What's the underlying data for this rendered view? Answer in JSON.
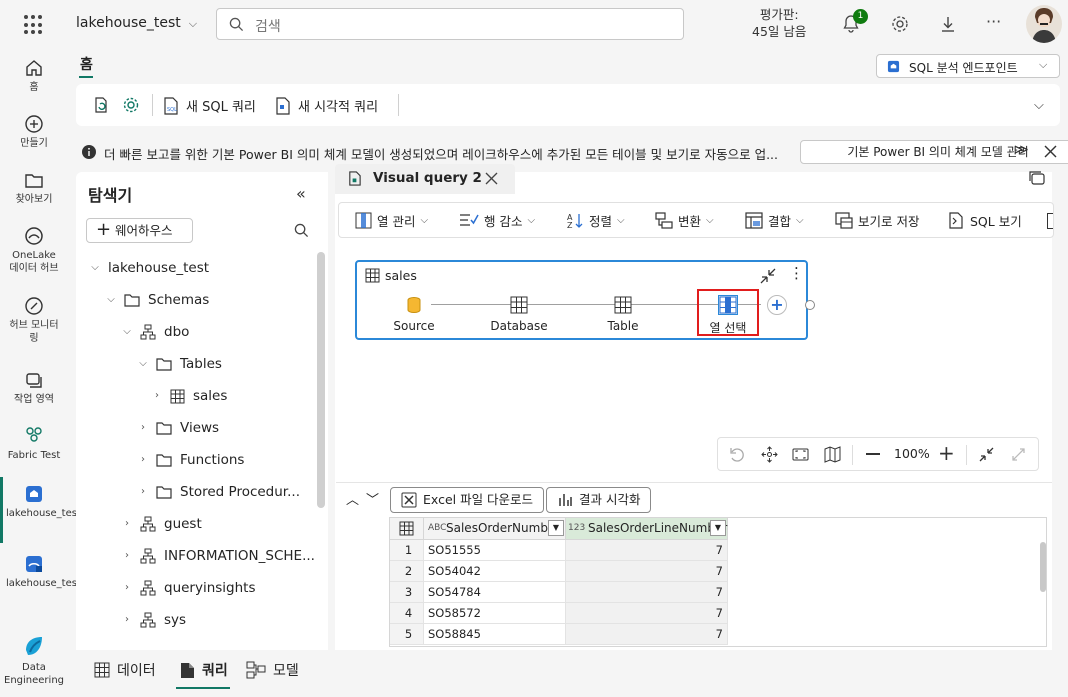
{
  "topbar": {
    "workspace": "lakehouse_test",
    "search_placeholder": "검색",
    "trial_line1": "평가판:",
    "trial_line2": "45일 남음",
    "notifications_count": "1"
  },
  "nav": {
    "items": [
      {
        "label": "홈"
      },
      {
        "label": "만들기"
      },
      {
        "label": "찾아보기"
      },
      {
        "label": "OneLake 데이터 허브"
      },
      {
        "label": "허브 모니터링"
      },
      {
        "label": "작업 영역"
      },
      {
        "label": "Fabric Test"
      },
      {
        "label": "lakehouse_test"
      },
      {
        "label": "lakehouse_test"
      },
      {
        "label": "Data Engineering"
      }
    ]
  },
  "header": {
    "home_tab": "홈",
    "endpoint": "SQL 분석 엔드포인트"
  },
  "ribbon": {
    "new_sql_query": "새 SQL 쿼리",
    "new_visual_query": "새 시각적 쿼리"
  },
  "infobar": {
    "message": "더 빠른 보고를 위한 기본 Power BI 의미 체계 모델이 생성되었으며 레이크하우스에 추가된 모든 테이블 및 보기로 자동으로 업...",
    "manage_button": "기본 Power BI 의미 체계 모델 관리"
  },
  "explorer": {
    "title": "탐색기",
    "add_warehouse": "웨어하우스",
    "tree": [
      {
        "label": "lakehouse_test"
      },
      {
        "label": "Schemas"
      },
      {
        "label": "dbo"
      },
      {
        "label": "Tables"
      },
      {
        "label": "sales"
      },
      {
        "label": "Views"
      },
      {
        "label": "Functions"
      },
      {
        "label": "Stored Procedur..."
      },
      {
        "label": "guest"
      },
      {
        "label": "INFORMATION_SCHE..."
      },
      {
        "label": "queryinsights"
      },
      {
        "label": "sys"
      }
    ]
  },
  "query": {
    "tab_title": "Visual query 2",
    "toolbar": {
      "manage_columns": "열 관리",
      "reduce_rows": "행 감소",
      "sort": "정렬",
      "transform": "변환",
      "combine": "결합",
      "save_as_view": "보기로 저장",
      "view_sql": "SQL 보기"
    },
    "card_title": "sales",
    "steps": [
      {
        "label": "Source"
      },
      {
        "label": "Database"
      },
      {
        "label": "Table"
      },
      {
        "label": "열 선택"
      }
    ],
    "zoom": "100%"
  },
  "results": {
    "download_excel": "Excel 파일 다운로드",
    "visualize": "결과 시각화",
    "columns": [
      {
        "name": "SalesOrderNumber",
        "type": "ABC"
      },
      {
        "name": "SalesOrderLineNumber",
        "type": "123"
      }
    ],
    "rows": [
      {
        "n": "1",
        "order": "SO51555",
        "line": "7"
      },
      {
        "n": "2",
        "order": "SO54042",
        "line": "7"
      },
      {
        "n": "3",
        "order": "SO54784",
        "line": "7"
      },
      {
        "n": "4",
        "order": "SO58572",
        "line": "7"
      },
      {
        "n": "5",
        "order": "SO58845",
        "line": "7"
      }
    ]
  },
  "bottom_tabs": {
    "data": "데이터",
    "query": "쿼리",
    "model": "모델"
  },
  "colors": {
    "accent": "#117865",
    "selection_border": "#2b88d8",
    "highlight": "#e11d1d"
  }
}
